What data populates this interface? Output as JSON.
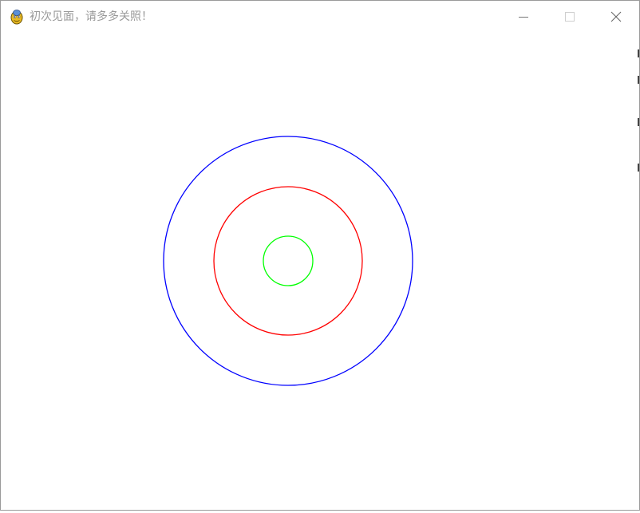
{
  "window": {
    "title": "初次见面，请多多关照！",
    "app_icon": "pygame-snake-icon",
    "controls": {
      "minimize_icon": "minimize-icon",
      "maximize_icon": "maximize-icon",
      "close_icon": "close-icon"
    }
  },
  "canvas": {
    "background": "#ffffff",
    "circles": [
      {
        "name": "outer-circle",
        "color": "#0000ff"
      },
      {
        "name": "middle-circle",
        "color": "#ff0000"
      },
      {
        "name": "inner-circle",
        "color": "#00ff00"
      }
    ]
  }
}
